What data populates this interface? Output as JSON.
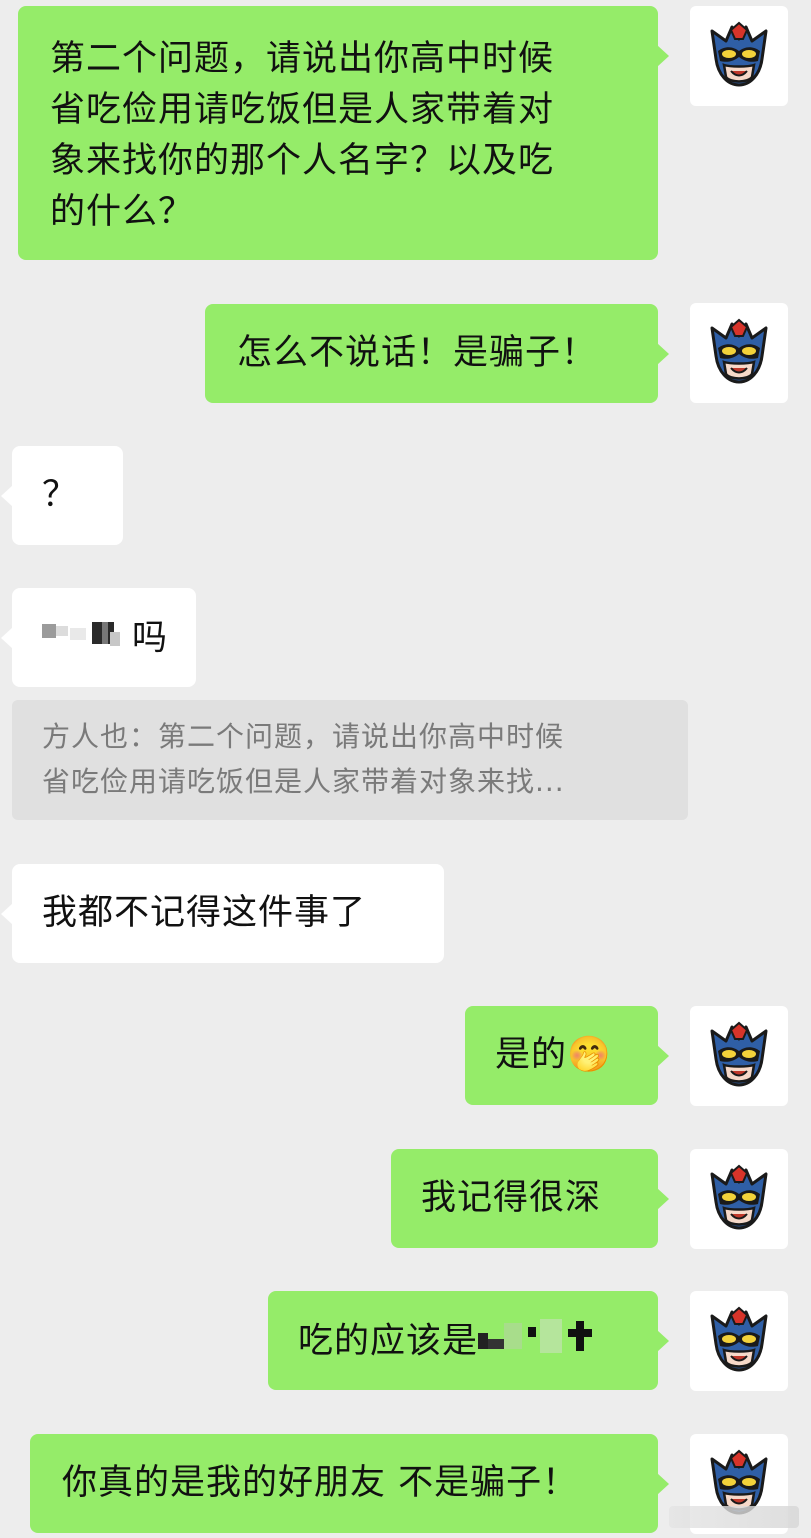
{
  "colors": {
    "outgoing_bubble": "#95ec69",
    "incoming_bubble": "#ffffff",
    "background": "#ededed",
    "quote_bg": "#e0e0e0"
  },
  "avatar_icon": "masked-hero-avatar-icon",
  "messages": [
    {
      "side": "out",
      "lines": [
        "第二个问题，请说出你高中时候",
        "省吃俭用请吃饭但是人家带着对",
        "象来找你的那个人名字？以及吃",
        "的什么？"
      ]
    },
    {
      "side": "out",
      "text": "怎么不说话！是骗子！"
    },
    {
      "side": "in",
      "text": "？"
    },
    {
      "side": "in",
      "text_suffix": "吗",
      "censored": true
    },
    {
      "quote": {
        "line1": "方人也：第二个问题，请说出你高中时候",
        "line2": "省吃俭用请吃饭但是人家带着对象来找..."
      }
    },
    {
      "side": "in",
      "text": "我都不记得这件事了"
    },
    {
      "side": "out",
      "text": "是的",
      "emoji": "🤭"
    },
    {
      "side": "out",
      "text": "我记得很深"
    },
    {
      "side": "out",
      "text": "吃的应该是",
      "censored": true
    },
    {
      "side": "out",
      "text": "你真的是我的好朋友 不是骗子！"
    }
  ]
}
